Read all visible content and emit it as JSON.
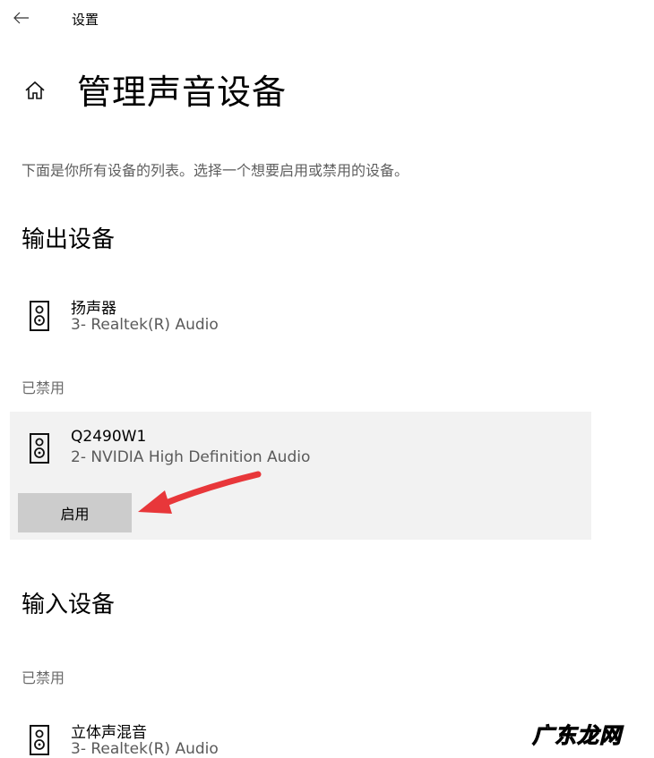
{
  "titlebar": {
    "app_title": "设置",
    "back_icon": "arrow-left-icon"
  },
  "header": {
    "home_icon": "home-icon",
    "title": "管理声音设备"
  },
  "description": "下面是你所有设备的列表。选择一个想要启用或禁用的设备。",
  "output": {
    "heading": "输出设备",
    "devices": [
      {
        "name": "扬声器",
        "detail": "3- Realtek(R) Audio",
        "icon": "speaker-icon"
      }
    ],
    "disabled_label": "已禁用",
    "disabled_devices": [
      {
        "name": "Q2490W1",
        "detail": "2- NVIDIA High Definition Audio",
        "icon": "speaker-icon",
        "action_label": "启用"
      }
    ]
  },
  "input": {
    "heading": "输入设备",
    "disabled_label": "已禁用",
    "disabled_devices": [
      {
        "name": "立体声混音",
        "detail": "3- Realtek(R) Audio",
        "icon": "speaker-icon"
      }
    ]
  },
  "annotation": {
    "arrow_color": "#e8373a",
    "arrow_icon": "red-arrow-icon"
  },
  "watermark": "广东龙网"
}
